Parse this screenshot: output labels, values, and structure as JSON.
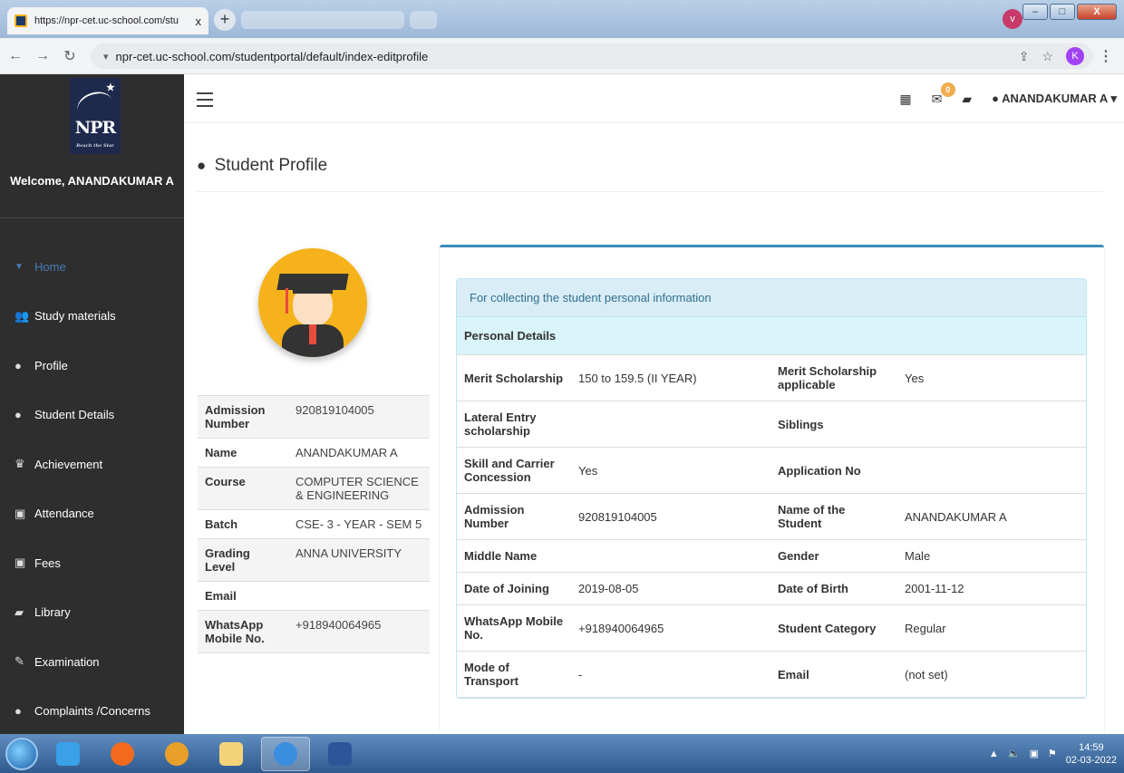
{
  "browser": {
    "tab_title": "https://npr-cet.uc-school.com/stu",
    "tab_close": "x",
    "new_tab": "+",
    "tab_menu": "v",
    "url": "npr-cet.uc-school.com/studentportal/default/index-editprofile",
    "profile_initial": "K"
  },
  "sidebar": {
    "logo_text": "NPR",
    "logo_tagline": "Reach the Star",
    "welcome": "Welcome, ANANDAKUMAR A",
    "items": [
      {
        "label": "Home",
        "icon": "chevron-down-icon"
      },
      {
        "label": "Study materials",
        "icon": "users-icon"
      },
      {
        "label": "Profile",
        "icon": "user-icon"
      },
      {
        "label": "Student Details",
        "icon": "user-icon"
      },
      {
        "label": "Achievement",
        "icon": "trophy-icon"
      },
      {
        "label": "Attendance",
        "icon": "money-icon"
      },
      {
        "label": "Fees",
        "icon": "money-icon"
      },
      {
        "label": "Library",
        "icon": "book-icon"
      },
      {
        "label": "Examination",
        "icon": "pencil-icon"
      },
      {
        "label": "Complaints /Concerns",
        "icon": "comment-icon"
      }
    ]
  },
  "topnav": {
    "notification_count": "0",
    "user_name": "ANANDAKUMAR A"
  },
  "page": {
    "title": "Student Profile"
  },
  "summary": [
    {
      "key": "Admission Number",
      "value": "920819104005"
    },
    {
      "key": "Name",
      "value": "ANANDAKUMAR A"
    },
    {
      "key": "Course",
      "value": "COMPUTER SCIENCE & ENGINEERING"
    },
    {
      "key": "Batch",
      "value": "CSE- 3 - YEAR - SEM 5"
    },
    {
      "key": "Grading Level",
      "value": "ANNA UNIVERSITY"
    },
    {
      "key": "Email",
      "value": ""
    },
    {
      "key": "WhatsApp Mobile No.",
      "value": "+918940064965"
    }
  ],
  "details": {
    "header": "For collecting the student personal information",
    "section": "Personal Details",
    "rows": [
      [
        "Merit Scholarship",
        "150 to 159.5 (II YEAR)",
        "Merit Scholarship applicable",
        "Yes"
      ],
      [
        "Lateral Entry scholarship",
        "",
        "Siblings",
        ""
      ],
      [
        "Skill and Carrier Concession",
        "Yes",
        "Application No",
        ""
      ],
      [
        "Admission Number",
        "920819104005",
        "Name of the Student",
        "ANANDAKUMAR A"
      ],
      [
        "Middle Name",
        "",
        "Gender",
        "Male"
      ],
      [
        "Date of Joining",
        "2019-08-05",
        "Date of Birth",
        "2001-11-12"
      ],
      [
        "WhatsApp Mobile No.",
        "+918940064965",
        "Student Category",
        "Regular"
      ],
      [
        "Mode of Transport",
        "-",
        "Email",
        "(not set)"
      ]
    ]
  },
  "taskbar": {
    "time": "14:59",
    "date": "02-03-2022"
  }
}
